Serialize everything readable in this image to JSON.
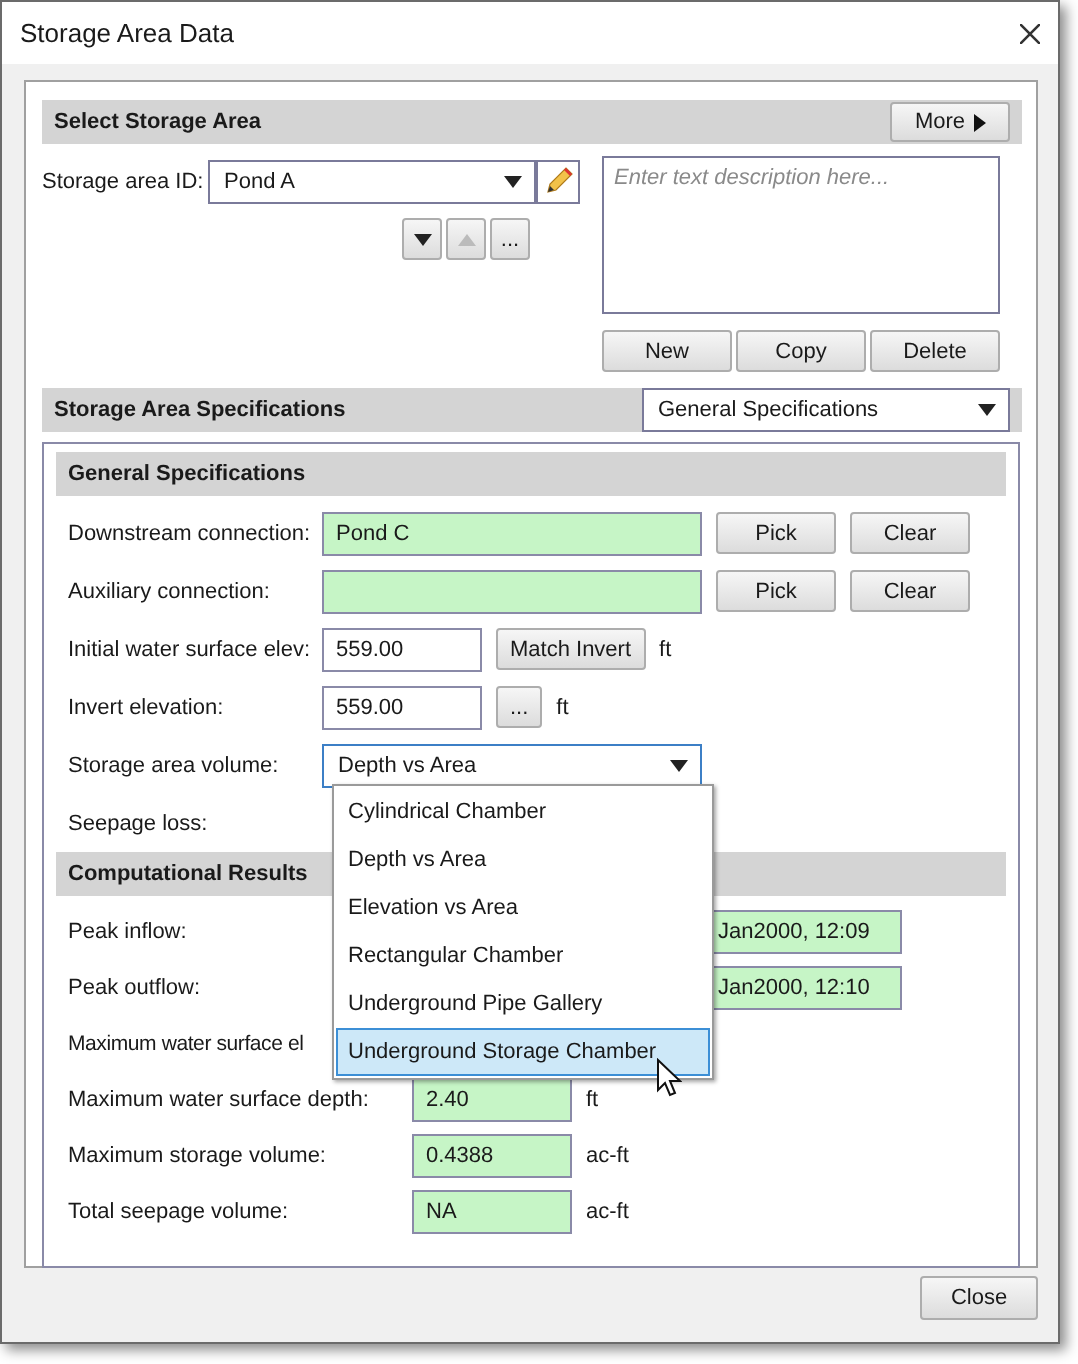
{
  "window": {
    "title": "Storage Area Data"
  },
  "select_storage_area": {
    "title": "Select Storage Area",
    "more_button": "More",
    "id_label": "Storage area ID:",
    "id_value": "Pond A",
    "description_placeholder": "Enter text description here...",
    "nav": [
      {
        "kind": "down",
        "disabled": false
      },
      {
        "kind": "up",
        "disabled": true
      },
      {
        "kind": "browse",
        "label": "...",
        "disabled": false
      }
    ],
    "buttons": [
      "New",
      "Copy",
      "Delete"
    ]
  },
  "specifications": {
    "title": "Storage Area Specifications",
    "view": "General Specifications"
  },
  "general": {
    "title": "General Specifications",
    "rows": [
      {
        "kind": "connection",
        "label": "Downstream connection:",
        "value": "Pond C",
        "buttons": [
          "Pick",
          "Clear"
        ]
      },
      {
        "kind": "connection",
        "label": "Auxiliary connection:",
        "value": "",
        "buttons": [
          "Pick",
          "Clear"
        ]
      },
      {
        "kind": "input",
        "label": "Initial water surface elev:",
        "value": "559.00",
        "button": "Match Invert",
        "unit": "ft"
      },
      {
        "kind": "input",
        "label": "Invert elevation:",
        "value": "559.00",
        "button": "...",
        "unit": "ft"
      },
      {
        "kind": "combo",
        "label": "Storage area volume:",
        "value": "Depth vs Area"
      },
      {
        "kind": "label",
        "label": "Seepage loss:"
      }
    ]
  },
  "dropdown": {
    "items": [
      {
        "label": "Cylindrical Chamber",
        "selected": false
      },
      {
        "label": "Depth vs Area",
        "selected": false
      },
      {
        "label": "Elevation vs Area",
        "selected": false
      },
      {
        "label": "Rectangular Chamber",
        "selected": false
      },
      {
        "label": "Underground Pipe Gallery",
        "selected": false
      },
      {
        "label": "Underground Storage Chamber",
        "selected": true
      }
    ]
  },
  "results": {
    "title": "Computational Results",
    "rows": [
      {
        "kind": "partial",
        "label": "Peak inflow:",
        "value": "Jan2000, 12:09"
      },
      {
        "kind": "partial",
        "label": "Peak outflow:",
        "value": "Jan2000, 12:10"
      },
      {
        "kind": "label",
        "label": "Maximum water surface el"
      },
      {
        "kind": "field",
        "label": "Maximum water surface depth:",
        "value": "2.40",
        "unit": "ft"
      },
      {
        "kind": "field",
        "label": "Maximum storage volume:",
        "value": "0.4388",
        "unit": "ac-ft"
      },
      {
        "kind": "field",
        "label": "Total seepage volume:",
        "value": "NA",
        "unit": "ac-ft"
      }
    ]
  },
  "close_button": "Close"
}
